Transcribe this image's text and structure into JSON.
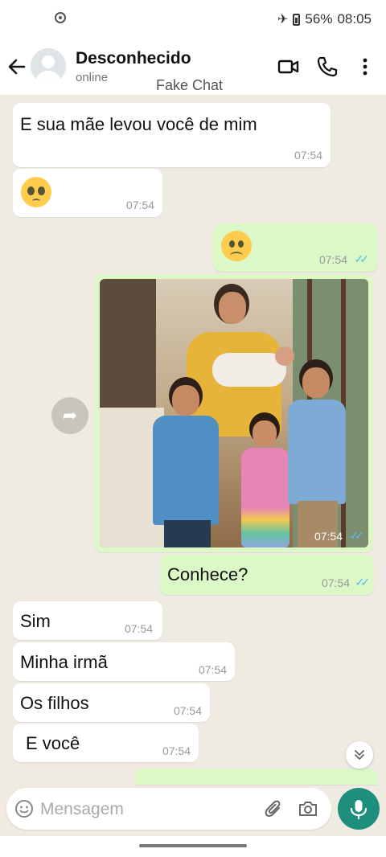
{
  "status_bar": {
    "battery": "56%",
    "time": "08:05"
  },
  "header": {
    "contact_name": "Desconhecido",
    "contact_status": "online",
    "overlay_label": "Fake Chat"
  },
  "messages": [
    {
      "text": "E sua mãe levou você de mim",
      "time": "07:54"
    },
    {
      "emoji": "pleading-face",
      "time": "07:54"
    },
    {
      "emoji": "slightly-frowning-face",
      "time": "07:54"
    },
    {
      "image": "family-photo",
      "time": "07:54"
    },
    {
      "text": "Conhece?",
      "time": "07:54"
    },
    {
      "text": "Sim",
      "time": "07:54"
    },
    {
      "text": "Minha irmã",
      "time": "07:54"
    },
    {
      "text": "Os filhos",
      "time": "07:54"
    },
    {
      "text": "E você",
      "time": "07:54"
    }
  ],
  "composer": {
    "placeholder": "Mensagem"
  },
  "colors": {
    "accent": "#1f8f7d",
    "incoming": "#ffffff",
    "outgoing": "#dcf8c6",
    "read_ticks": "#53bdeb",
    "background": "#efeae2"
  }
}
